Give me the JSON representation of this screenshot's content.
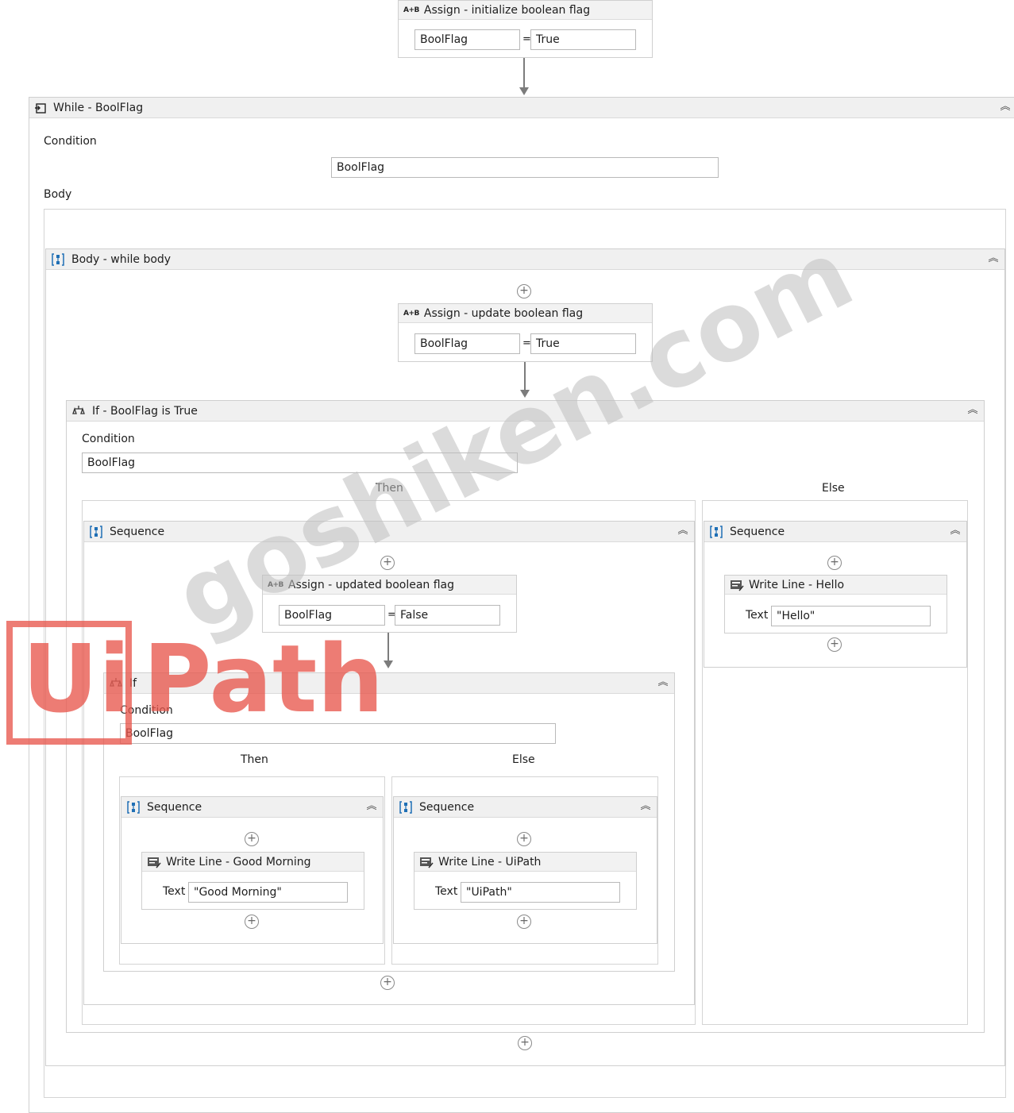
{
  "assign_init": {
    "title": "Assign - initialize boolean flag",
    "to": "BoolFlag",
    "eq": "=",
    "value": "True"
  },
  "while": {
    "title": "While - BoolFlag",
    "condition_label": "Condition",
    "condition": "BoolFlag",
    "body_label": "Body"
  },
  "body_seq": {
    "title": "Body - while body"
  },
  "assign_update": {
    "title": "Assign - update boolean flag",
    "to": "BoolFlag",
    "eq": "=",
    "value": "True"
  },
  "if_outer": {
    "title": "If - BoolFlag is True",
    "condition_label": "Condition",
    "condition": "BoolFlag",
    "then_label": "Then",
    "else_label": "Else"
  },
  "then_seq": {
    "title": "Sequence"
  },
  "assign_updated": {
    "title": "Assign - updated boolean flag",
    "to": "BoolFlag",
    "eq": "=",
    "value": "False"
  },
  "if_inner": {
    "title": "If",
    "condition_label": "Condition",
    "condition": "BoolFlag",
    "then_label": "Then",
    "else_label": "Else"
  },
  "inner_then_seq": {
    "title": "Sequence"
  },
  "write_good_morning": {
    "title": "Write Line - Good Morning",
    "text_label": "Text",
    "text": "\"Good Morning\""
  },
  "inner_else_seq": {
    "title": "Sequence"
  },
  "write_uipath": {
    "title": "Write Line - UiPath",
    "text_label": "Text",
    "text": "\"UiPath\""
  },
  "else_seq": {
    "title": "Sequence"
  },
  "write_hello": {
    "title": "Write Line - Hello",
    "text_label": "Text",
    "text": "\"Hello\""
  },
  "icons": {
    "plus": "⊕",
    "collapse": "⌃⌃",
    "assign": "A+B"
  },
  "watermark": {
    "logo_text_ui": "Ui",
    "logo_text_path": "Path",
    "site": "goshiken.com"
  },
  "colors": {
    "accent": "#1f6fb5",
    "watermark_red": "#e8584e"
  }
}
